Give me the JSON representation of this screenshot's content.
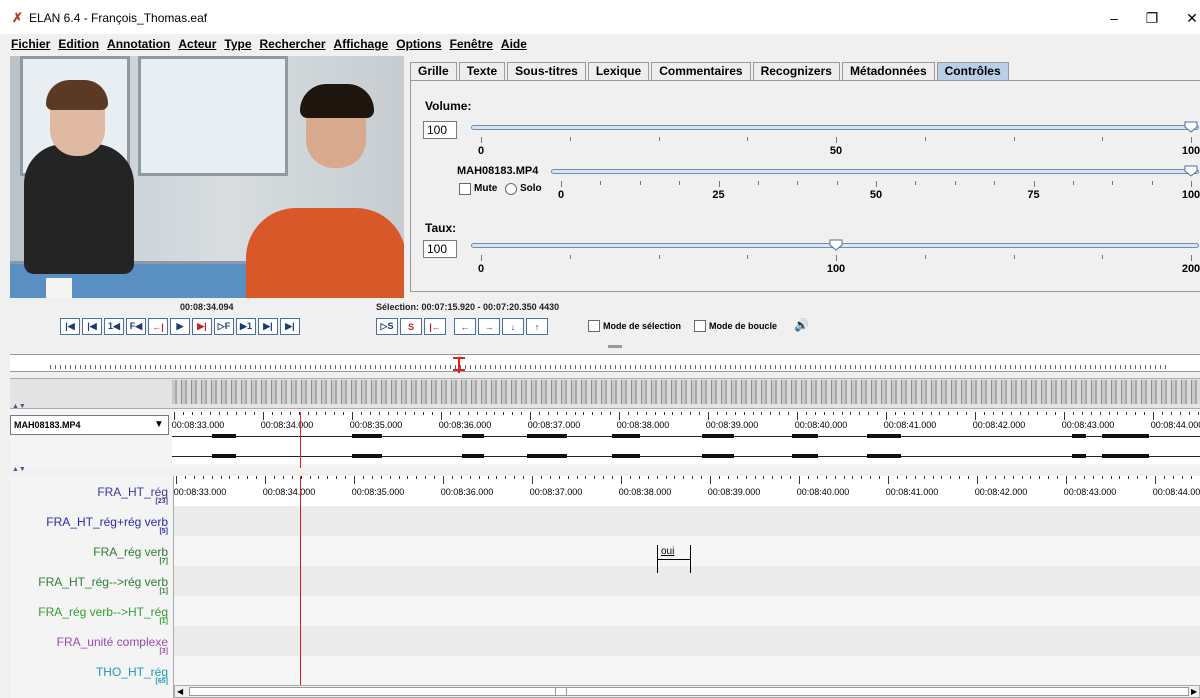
{
  "window": {
    "title": "ELAN 6.4 - François_Thomas.eaf",
    "minimize": "–",
    "restore": "❐",
    "close": "✕"
  },
  "menu": [
    "Fichier",
    "Edition",
    "Annotation",
    "Acteur",
    "Type",
    "Rechercher",
    "Affichage",
    "Options",
    "Fenêtre",
    "Aide"
  ],
  "tabs": [
    {
      "label": "Grille"
    },
    {
      "label": "Texte"
    },
    {
      "label": "Sous-titres"
    },
    {
      "label": "Lexique"
    },
    {
      "label": "Commentaires"
    },
    {
      "label": "Recognizers"
    },
    {
      "label": "Métadonnées"
    },
    {
      "label": "Contrôles",
      "active": true
    }
  ],
  "controls": {
    "volume_label": "Volume:",
    "volume_value": "100",
    "volume_level": 100,
    "volume_ticks": [
      "0",
      "50",
      "100"
    ],
    "media_name": "MAH08183.MP4",
    "media_level": 100,
    "media_ticks": [
      "0",
      "25",
      "50",
      "75",
      "100"
    ],
    "mute_label": "Mute",
    "solo_label": "Solo",
    "rate_label": "Taux:",
    "rate_value": "100",
    "rate_level": 100,
    "rate_ticks": [
      "0",
      "100",
      "200"
    ]
  },
  "player": {
    "current_time": "00:08:34.094",
    "selection": "Sélection: 00:07:15.920 - 00:07:20.350  4430",
    "selection_mode": "Mode de sélection",
    "loop_mode": "Mode de boucle",
    "buttons": [
      "|◀",
      "|◀",
      "1◀",
      "F◀",
      "←|",
      "▶",
      "▶|",
      "▷F",
      "▶1",
      "▶|",
      "▶|"
    ],
    "sel_buttons": [
      "▷S",
      "S",
      "|←",
      "←",
      "→",
      "↓",
      "↑"
    ]
  },
  "timeline": {
    "media_select": "MAH08183.MP4",
    "ticks": [
      "00:08:33.000",
      "00:08:34.000",
      "00:08:35.000",
      "00:08:36.000",
      "00:08:37.000",
      "00:08:38.000",
      "00:08:39.000",
      "00:08:40.000",
      "00:08:41.000",
      "00:08:42.000",
      "00:08:43.000",
      "00:08:44.000"
    ]
  },
  "tiers": [
    {
      "name": "FRA_HT_rég",
      "count": "[23]",
      "color": "#3a3a9a"
    },
    {
      "name": "FRA_HT_rég+rég verb",
      "count": "[5]",
      "color": "#2a2ab0"
    },
    {
      "name": "FRA_rég verb",
      "count": "[7]",
      "color": "#2e7d32"
    },
    {
      "name": "FRA_HT_rég-->rég verb",
      "count": "[1]",
      "color": "#2e7d32"
    },
    {
      "name": "FRA_rég verb-->HT_rég",
      "count": "[1]",
      "color": "#2fa02f"
    },
    {
      "name": "FRA_unité complexe",
      "count": "[3]",
      "color": "#9a4ab0"
    },
    {
      "name": "THO_HT_rég",
      "count": "[65]",
      "color": "#1e9ab0"
    }
  ],
  "annotation": {
    "text": "oui"
  },
  "colors": {
    "accent": "#b8cfe5",
    "cursor": "#e02020"
  }
}
